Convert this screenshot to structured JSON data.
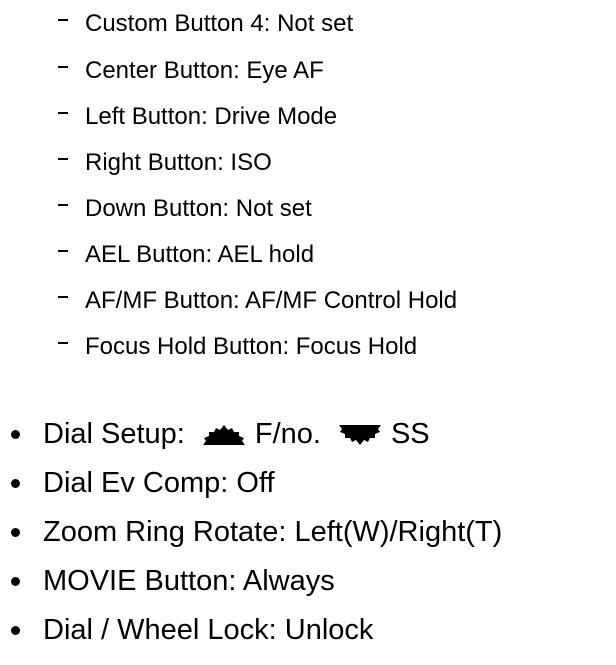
{
  "sub_items": [
    "Custom Button 4: Not set",
    "Center Button: Eye AF",
    "Left Button: Drive Mode",
    "Right Button: ISO",
    "Down Button: Not set",
    "AEL Button: AEL hold",
    "AF/MF Button: AF/MF Control Hold",
    "Focus Hold Button: Focus Hold"
  ],
  "dial_setup": {
    "label": "Dial Setup:",
    "front_value": "F/no.",
    "rear_value": "SS",
    "front_icon": "front-dial-icon",
    "rear_icon": "rear-dial-icon"
  },
  "main_items": [
    "Dial Ev Comp: Off",
    "Zoom Ring Rotate: Left(W)/Right(T)",
    "MOVIE Button: Always",
    "Dial / Wheel Lock: Unlock"
  ]
}
